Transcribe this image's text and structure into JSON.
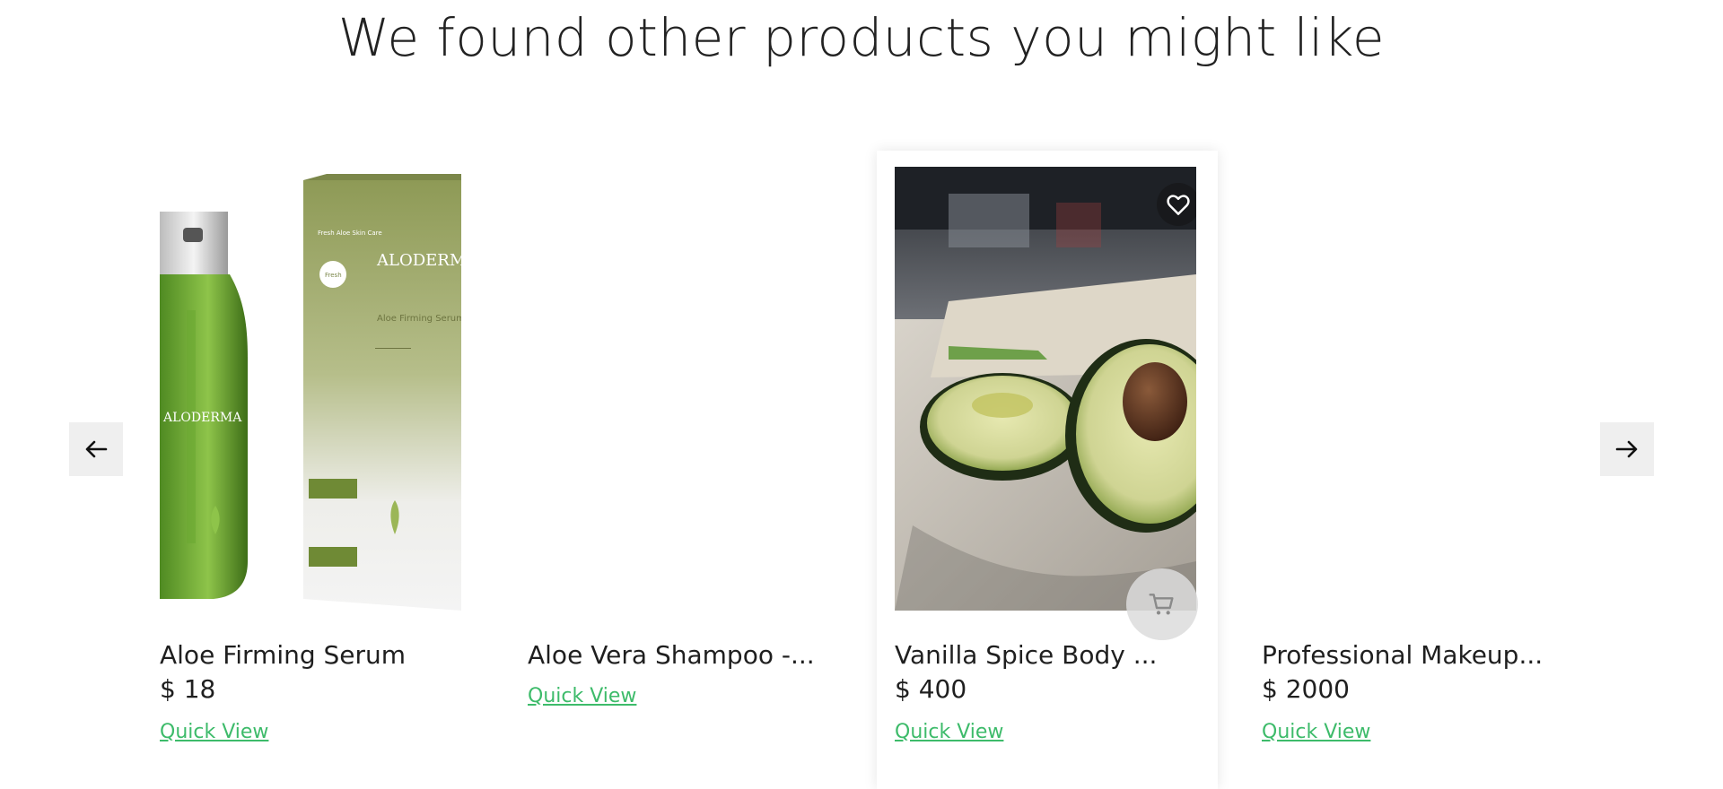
{
  "section": {
    "title": "We found other products you might like"
  },
  "carousel": {
    "prev_icon": "arrow-left-icon",
    "next_icon": "arrow-right-icon",
    "products": [
      {
        "name": "Aloe Firming Serum",
        "price": "$ 18",
        "quick_view": "Quick View",
        "image": "serum-bottle-and-box",
        "bottle_brand": "ALODERMA",
        "box_brand": "ALODERMA",
        "box_product": "Aloe Firming Serum",
        "box_header": "Fresh Aloe Skin Care",
        "box_badge": "Fresh"
      },
      {
        "name": "Aloe Vera Shampoo -...",
        "price": "",
        "quick_view": "Quick View",
        "image": "none"
      },
      {
        "name": "Vanilla Spice Body ...",
        "price": "$ 400",
        "quick_view": "Quick View",
        "image": "avocado-halves",
        "wishlist_icon": "heart-icon",
        "cart_icon": "cart-icon"
      },
      {
        "name": "Professional Makeup...",
        "price": "$ 2000",
        "quick_view": "Quick View",
        "image": "none"
      }
    ]
  },
  "colors": {
    "link": "#3dbb6a",
    "arrow_bg": "#efefef",
    "serum_green": "#5f9a2c"
  }
}
